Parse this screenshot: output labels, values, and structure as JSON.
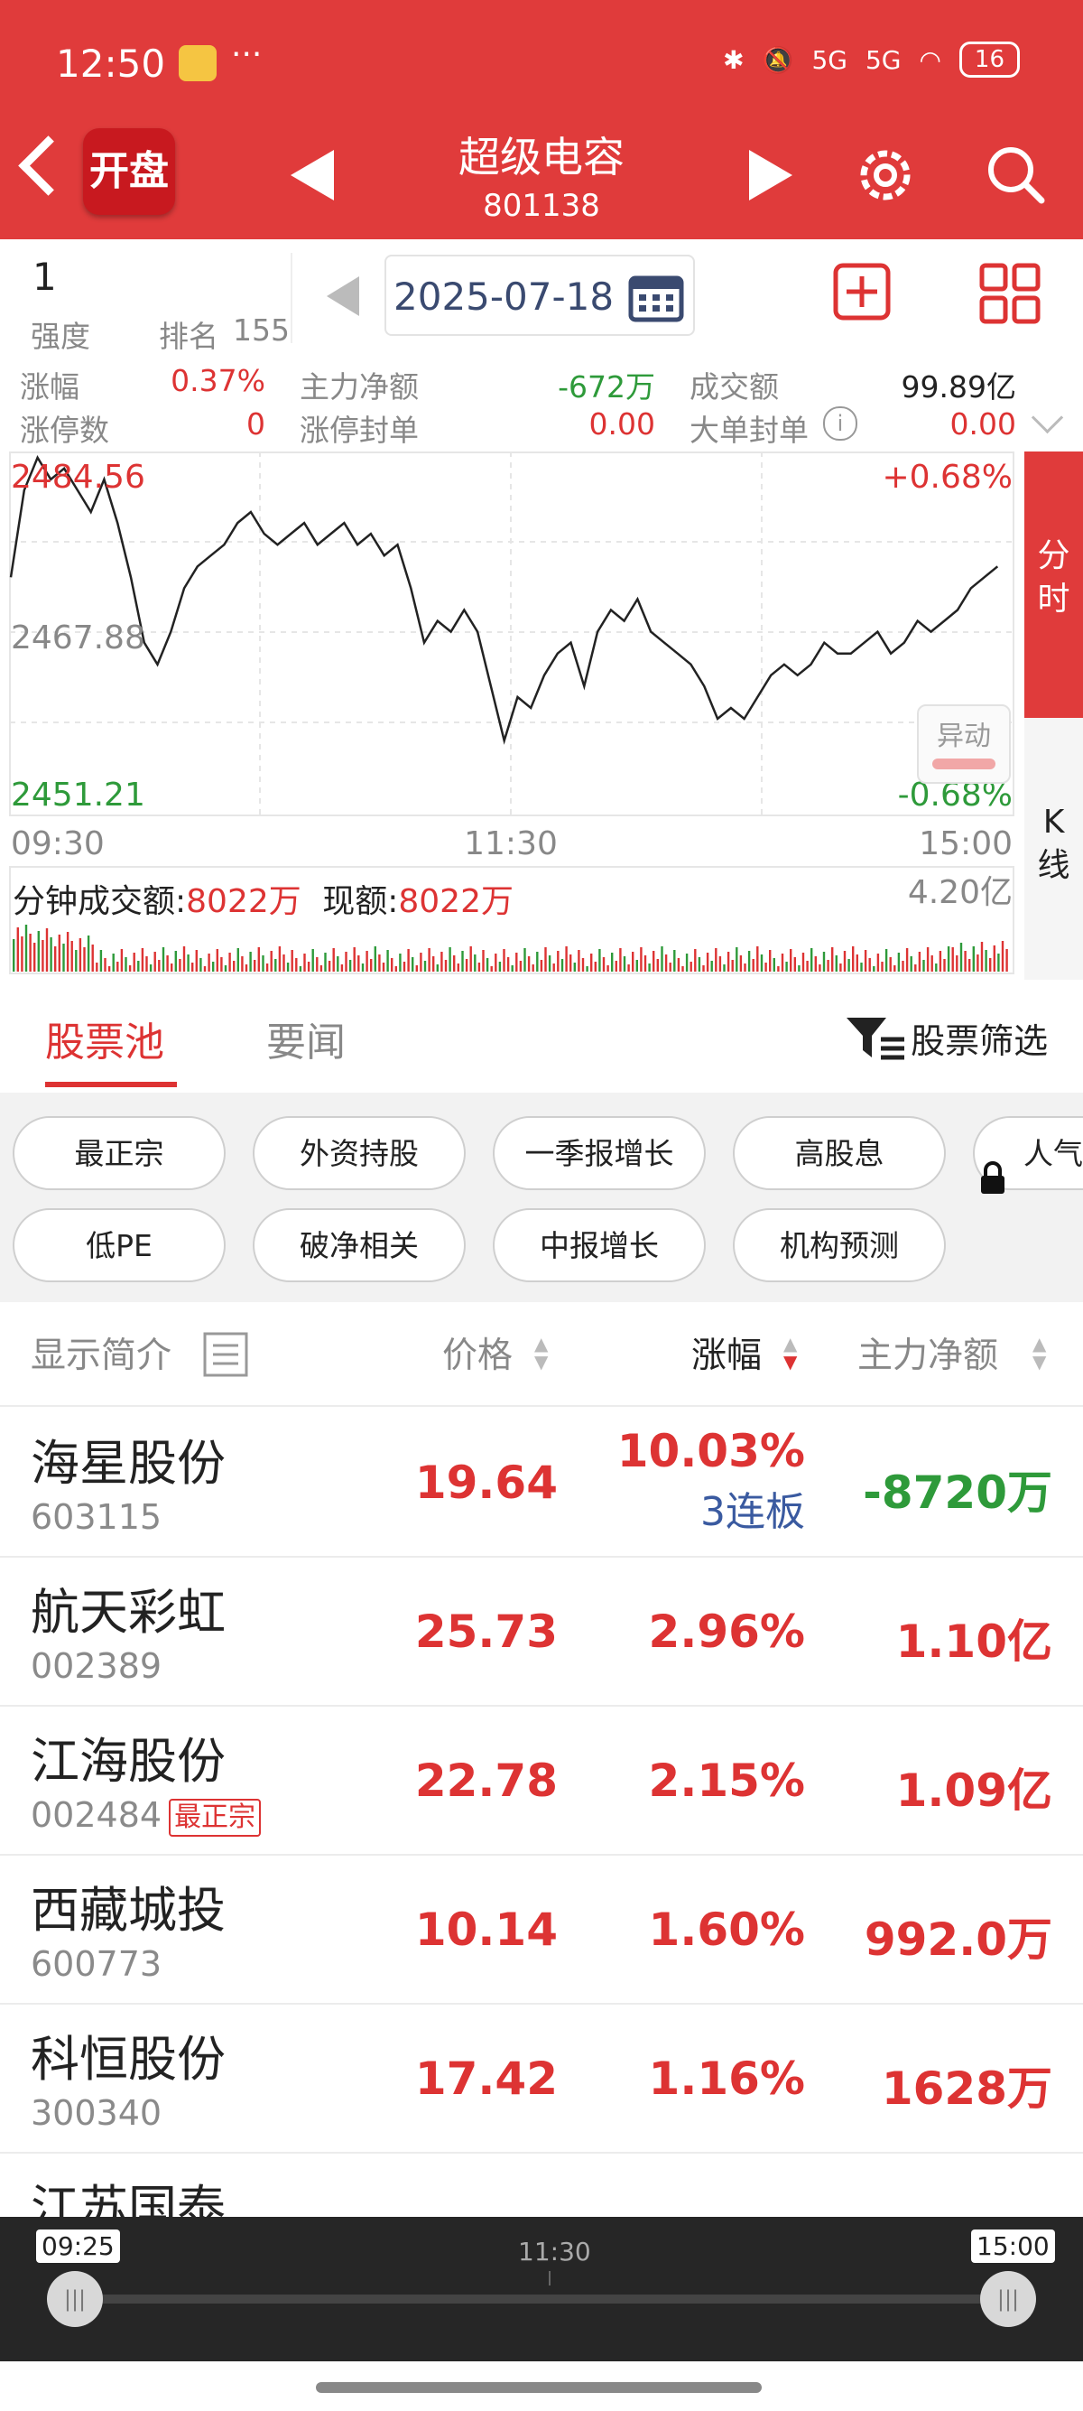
{
  "status": {
    "time": "12:50",
    "dots": "···",
    "battery": "16",
    "net1": "5G",
    "net2": "5G"
  },
  "nav": {
    "title": "超级电容",
    "code": "801138",
    "badge": "开盘"
  },
  "info": {
    "strength_value": "1",
    "strength_label": "强度",
    "rank_label": "排名",
    "rank_value": "155",
    "date": "2025-07-18",
    "rows": [
      {
        "label": "涨幅",
        "value": "0.37%",
        "label2": "主力净额",
        "value2": "-672万",
        "label3": "成交额",
        "value3": "99.89亿"
      },
      {
        "label": "涨停数",
        "value": "0",
        "label2": "涨停封单",
        "value2": "0.00",
        "label3": "大单封单",
        "value3": "0.00"
      }
    ]
  },
  "chart_data": {
    "type": "line",
    "y_labels": {
      "top": "2484.56",
      "mid": "2467.88",
      "bottom": "2451.21"
    },
    "pct_labels": {
      "top": "+0.68%",
      "bottom": "-0.68%"
    },
    "x_labels": [
      "09:30",
      "11:30",
      "15:00"
    ],
    "ylim": [
      2451.21,
      2484.56
    ],
    "series": [
      {
        "values": [
          2473,
          2481,
          2484,
          2482,
          2483,
          2481,
          2479,
          2482,
          2478,
          2473,
          2467,
          2465,
          2468,
          2472,
          2474,
          2475,
          2476,
          2478,
          2479,
          2477,
          2476,
          2477,
          2478,
          2476,
          2477,
          2478,
          2476,
          2477,
          2475,
          2476,
          2472,
          2467,
          2469,
          2468,
          2470,
          2468,
          2463,
          2458,
          2462,
          2461,
          2464,
          2466,
          2467,
          2463,
          2468,
          2470,
          2469,
          2471,
          2468,
          2467,
          2466,
          2465,
          2463,
          2460,
          2461,
          2460,
          2462,
          2464,
          2465,
          2464,
          2465,
          2467,
          2466,
          2466,
          2467,
          2468,
          2466,
          2467,
          2469,
          2468,
          2469,
          2470,
          2472,
          2473,
          2474
        ]
      }
    ],
    "volume_label": "分钟成交额:",
    "volume_value": "8022万",
    "now_label": "现额:",
    "now_value": "8022万",
    "volume_max": "4.20亿",
    "yidong": "异动"
  },
  "side_tabs": {
    "tab1": "分时",
    "tab2": "K线"
  },
  "tabs": {
    "pool": "股票池",
    "news": "要闻",
    "screener": "股票筛选"
  },
  "chips": [
    "最正宗",
    "外资持股",
    "一季报增长",
    "高股息",
    "人气",
    "低PE",
    "破净相关",
    "中报增长",
    "机构预测"
  ],
  "table": {
    "headers": {
      "name": "显示简介",
      "price": "价格",
      "change": "涨幅",
      "net": "主力净额"
    },
    "rows": [
      {
        "name": "海星股份",
        "code": "603115",
        "price": "19.64",
        "change": "10.03%",
        "extra": "3连板",
        "net": "-8720万",
        "net_color": "#2e9a3a"
      },
      {
        "name": "航天彩虹",
        "code": "002389",
        "price": "25.73",
        "change": "2.96%",
        "net": "1.10亿",
        "net_color": "#d33"
      },
      {
        "name": "江海股份",
        "code": "002484",
        "badge": "最正宗",
        "price": "22.78",
        "change": "2.15%",
        "net": "1.09亿",
        "net_color": "#d33"
      },
      {
        "name": "西藏城投",
        "code": "600773",
        "price": "10.14",
        "change": "1.60%",
        "net": "992.0万",
        "net_color": "#d33"
      },
      {
        "name": "科恒股份",
        "code": "300340",
        "price": "17.42",
        "change": "1.16%",
        "net": "1628万",
        "net_color": "#d33"
      },
      {
        "name": "江苏国泰",
        "code": "",
        "price": "",
        "change": "",
        "net": "",
        "net_color": "#2e9a3a"
      }
    ]
  },
  "slider": {
    "start": "09:25",
    "mid": "11:30",
    "end": "15:00"
  },
  "colors": {
    "brand": "#e03b3b",
    "up": "#d33",
    "down": "#2e9a3a"
  }
}
